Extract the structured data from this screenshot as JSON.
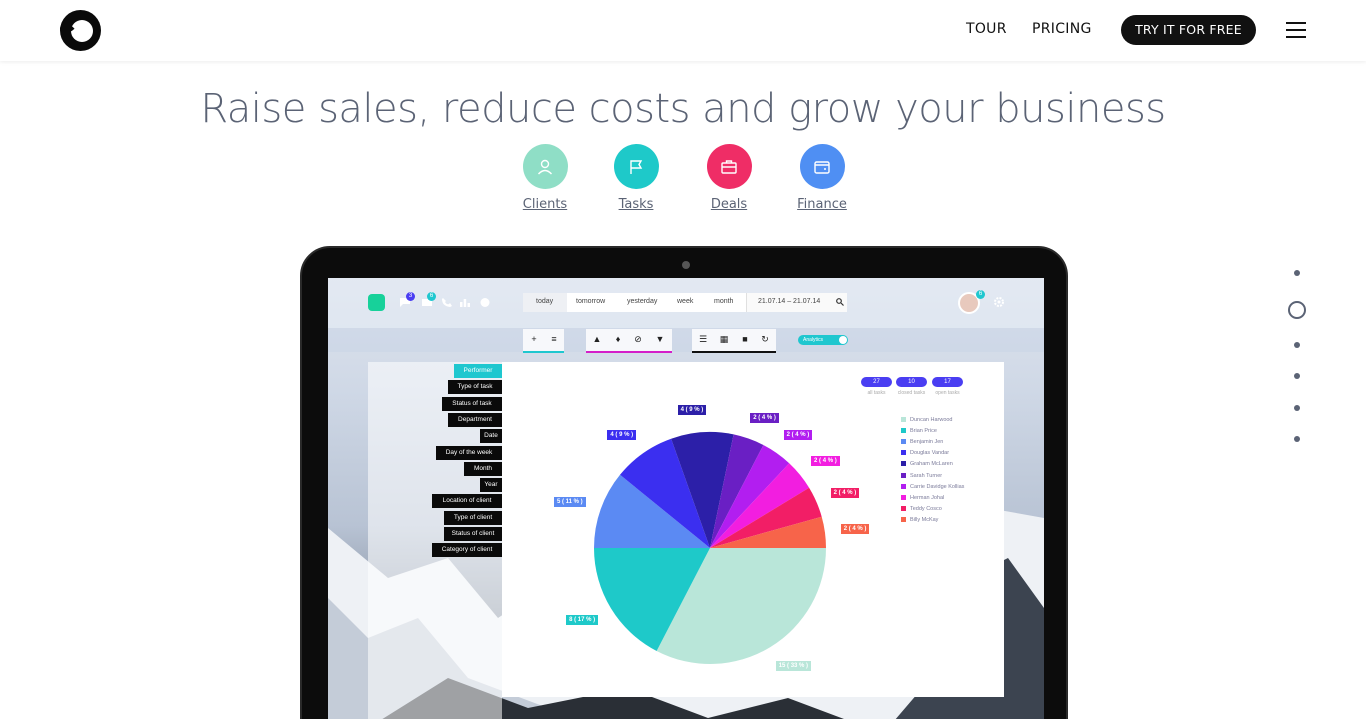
{
  "nav": {
    "tour": "TOUR",
    "pricing": "PRICING",
    "cta": "TRY IT FOR FREE"
  },
  "headline": "Raise sales, reduce costs and grow your business",
  "features": [
    {
      "label": "Clients",
      "color": "#8fdec6",
      "icon": "person-icon"
    },
    {
      "label": "Tasks",
      "color": "#1ec9c9",
      "icon": "flag-icon"
    },
    {
      "label": "Deals",
      "color": "#ef2d66",
      "icon": "briefcase-icon"
    },
    {
      "label": "Finance",
      "color": "#4f8ff3",
      "icon": "wallet-icon"
    }
  ],
  "app": {
    "badges": {
      "messages": "3",
      "mail": "6",
      "profile": "6"
    },
    "date_tabs": [
      "today",
      "tomorrow",
      "yesterday",
      "week",
      "month"
    ],
    "date_range": "21.07.14 – 21.07.14",
    "analytics_label": "Analytics",
    "filters": [
      "Performer",
      "Type of task",
      "Status of task",
      "Department",
      "Date",
      "Day of the week",
      "Month",
      "Year",
      "Location of client",
      "Type of client",
      "Status of client",
      "Category of client"
    ],
    "stats": [
      {
        "value": "27",
        "caption": "all tasks"
      },
      {
        "value": "10",
        "caption": "closed tasks"
      },
      {
        "value": "17",
        "caption": "open tasks"
      }
    ],
    "legend": [
      {
        "name": "Duncan Harwood",
        "color": "#b9e6d9"
      },
      {
        "name": "Brian Price",
        "color": "#1ec9c9"
      },
      {
        "name": "Benjamin Jen",
        "color": "#5b8af3"
      },
      {
        "name": "Douglas Vandar",
        "color": "#3b2ff0"
      },
      {
        "name": "Graham McLaren",
        "color": "#2c1fa8"
      },
      {
        "name": "Sarah Turner",
        "color": "#6a1fc4"
      },
      {
        "name": "Carrie Davidge Kollias",
        "color": "#b21ef0"
      },
      {
        "name": "Herman Johal",
        "color": "#f21ee0"
      },
      {
        "name": "Teddy Cosco",
        "color": "#f21e66"
      },
      {
        "name": "Billy McKay",
        "color": "#f7644a"
      }
    ]
  },
  "chart_data": {
    "type": "pie",
    "slices": [
      {
        "label": "15 ( 33 % )",
        "value": 15,
        "color": "#b9e6d9"
      },
      {
        "label": "8 ( 17 % )",
        "value": 8,
        "color": "#1ec9c9"
      },
      {
        "label": "5 ( 11 % )",
        "value": 5,
        "color": "#5b8af3"
      },
      {
        "label": "4 ( 9 % )",
        "value": 4,
        "color": "#3b2ff0"
      },
      {
        "label": "4 ( 9 % )",
        "value": 4,
        "color": "#2c1fa8"
      },
      {
        "label": "2 ( 4 % )",
        "value": 2,
        "color": "#6a1fc4"
      },
      {
        "label": "2 ( 4 % )",
        "value": 2,
        "color": "#b21ef0"
      },
      {
        "label": "2 ( 4 % )",
        "value": 2,
        "color": "#f21ee0"
      },
      {
        "label": "2 ( 4 % )",
        "value": 2,
        "color": "#f21e66"
      },
      {
        "label": "2 ( 4 % )",
        "value": 2,
        "color": "#f7644a"
      }
    ]
  }
}
